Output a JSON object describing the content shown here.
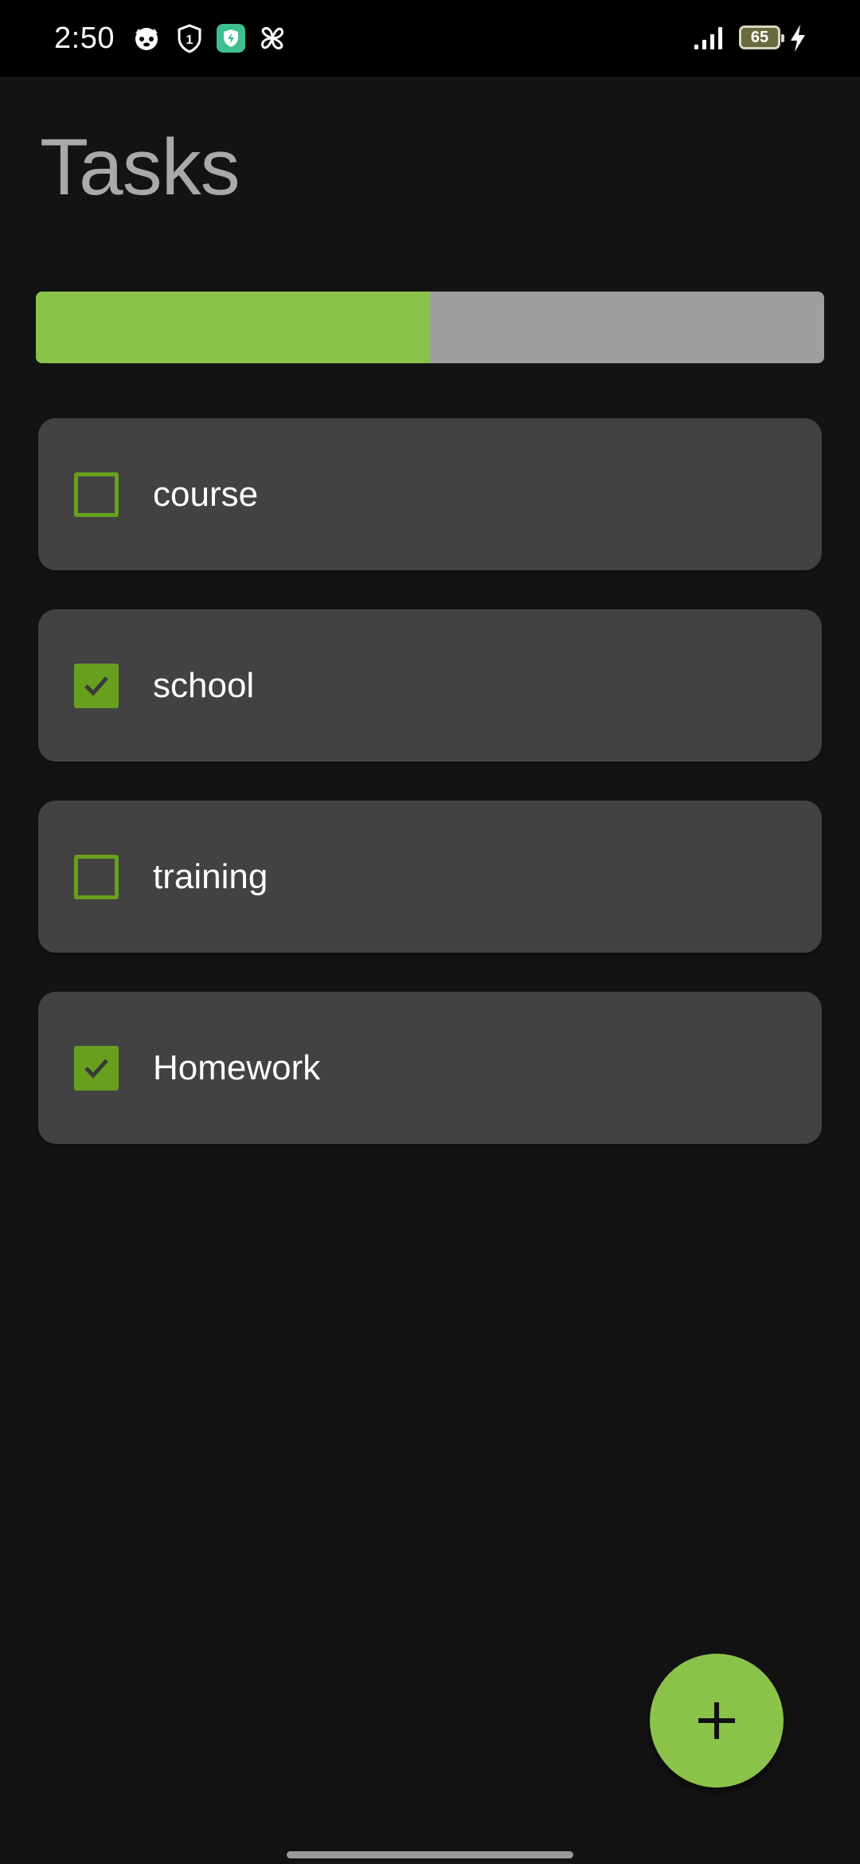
{
  "status_bar": {
    "time": "2:50",
    "battery_level": "65",
    "icons": [
      "face-app-icon",
      "shield-one-icon",
      "green-shield-app-icon",
      "pinwheel-icon",
      "signal-icon",
      "battery-icon",
      "charging-bolt-icon"
    ]
  },
  "header": {
    "title": "Tasks"
  },
  "progress": {
    "completed_fraction": 0.5,
    "fill_color": "#8bc34a",
    "track_color": "#9e9e9e"
  },
  "tasks": [
    {
      "label": "course",
      "checked": false
    },
    {
      "label": "school",
      "checked": true
    },
    {
      "label": "training",
      "checked": false
    },
    {
      "label": "Homework",
      "checked": true
    }
  ],
  "fab": {
    "icon": "plus-icon",
    "color": "#8bc34a"
  },
  "colors": {
    "accent": "#8bc34a",
    "checkbox": "#689f1f",
    "card": "#424242",
    "background": "#131313"
  }
}
